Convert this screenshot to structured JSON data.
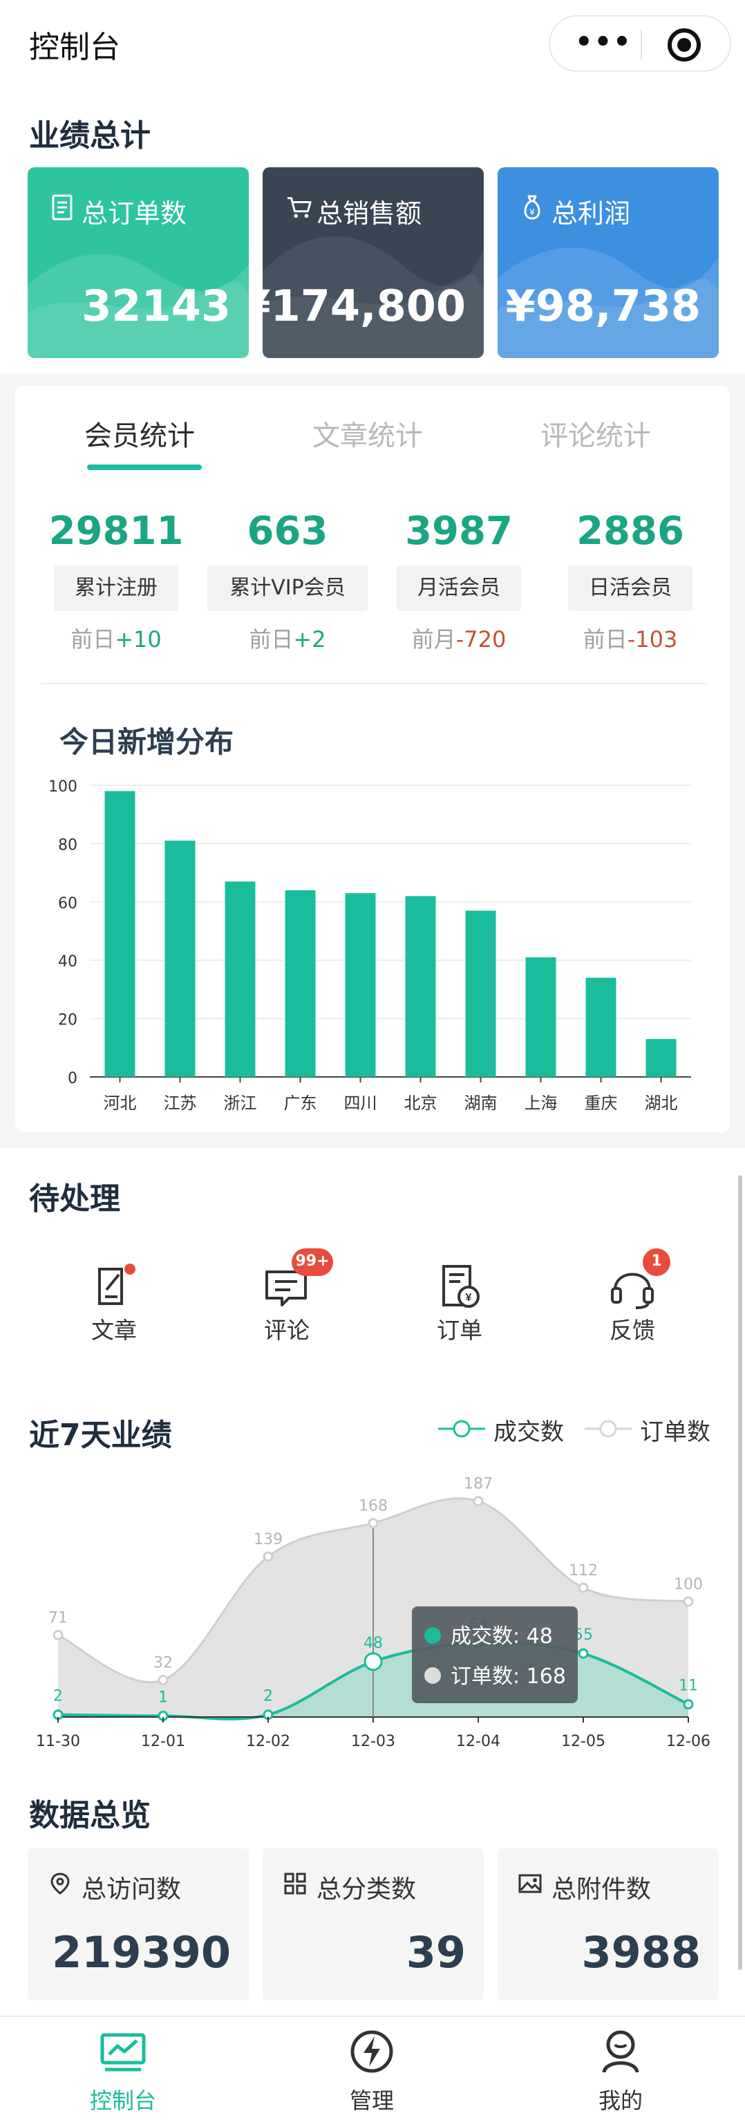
{
  "app": {
    "title": "控制台"
  },
  "performance": {
    "title": "业绩总计",
    "cards": [
      {
        "label": "总订单数",
        "value": "32143",
        "icon": "document-icon",
        "color": "#2ec4a0"
      },
      {
        "label": "总销售额",
        "value": "¥174,800",
        "icon": "cart-icon",
        "color": "#3a4554"
      },
      {
        "label": "总利润",
        "value": "¥98,738",
        "icon": "money-bag-icon",
        "color": "#3d8fe0"
      }
    ]
  },
  "stats": {
    "tabs": [
      {
        "label": "会员统计",
        "active": true
      },
      {
        "label": "文章统计",
        "active": false
      },
      {
        "label": "评论统计",
        "active": false
      }
    ],
    "items": [
      {
        "value": "29811",
        "label": "累计注册",
        "delta_prefix": "前日",
        "delta": "+10"
      },
      {
        "value": "663",
        "label": "累计VIP会员",
        "delta_prefix": "前日",
        "delta": "+2"
      },
      {
        "value": "3987",
        "label": "月活会员",
        "delta_prefix": "前月",
        "delta": "-720"
      },
      {
        "value": "2886",
        "label": "日活会员",
        "delta_prefix": "前日",
        "delta": "-103"
      }
    ]
  },
  "distribution": {
    "title": "今日新增分布"
  },
  "pending": {
    "title": "待处理",
    "items": [
      {
        "label": "文章",
        "icon": "article-edit-icon",
        "badge": ""
      },
      {
        "label": "评论",
        "icon": "comment-icon",
        "badge": "99+"
      },
      {
        "label": "订单",
        "icon": "order-icon",
        "badge": ""
      },
      {
        "label": "反馈",
        "icon": "headset-icon",
        "badge": "1"
      }
    ]
  },
  "recent": {
    "title": "近7天业绩",
    "tooltip": {
      "line1": "成交数: 48",
      "line2": "订单数: 168"
    }
  },
  "overview": {
    "title": "数据总览",
    "cards": [
      {
        "label": "总访问数",
        "value": "219390",
        "icon": "location-pin-icon"
      },
      {
        "label": "总分类数",
        "value": "39",
        "icon": "grid-icon"
      },
      {
        "label": "总附件数",
        "value": "3988",
        "icon": "image-icon"
      }
    ]
  },
  "nav": {
    "items": [
      {
        "label": "控制台",
        "icon": "dashboard-icon",
        "active": true
      },
      {
        "label": "管理",
        "icon": "lightning-icon",
        "active": false
      },
      {
        "label": "我的",
        "icon": "user-icon",
        "active": false
      }
    ]
  },
  "colors": {
    "accent": "#1abc9c",
    "bar": "#1abc9c",
    "orders_fill": "#d9d9d9",
    "deal_fill": "#a8dccf"
  },
  "chart_data": [
    {
      "type": "bar",
      "categories": [
        "河北",
        "江苏",
        "浙江",
        "广东",
        "四川",
        "北京",
        "湖南",
        "上海",
        "重庆",
        "湖北"
      ],
      "values": [
        98,
        81,
        67,
        64,
        63,
        62,
        57,
        41,
        34,
        13
      ],
      "ylim": [
        0,
        100
      ],
      "yticks": [
        "0",
        "20",
        "40",
        "60",
        "80",
        "100"
      ]
    },
    {
      "type": "area",
      "x": [
        "11-30",
        "12-01",
        "12-02",
        "12-03",
        "12-04",
        "12-05",
        "12-06"
      ],
      "series": [
        {
          "name": "成交数",
          "values": [
            2,
            1,
            2,
            48,
            64,
            55,
            11
          ],
          "labels": [
            "2",
            "1",
            "2",
            "48",
            "64",
            "55",
            "11"
          ]
        },
        {
          "name": "订单数",
          "values": [
            71,
            32,
            139,
            168,
            187,
            112,
            100
          ],
          "labels": [
            "71",
            "32",
            "139",
            "168",
            "187",
            "112",
            "100"
          ]
        }
      ],
      "ylim": [
        0,
        200
      ],
      "highlight_index": 3
    }
  ]
}
